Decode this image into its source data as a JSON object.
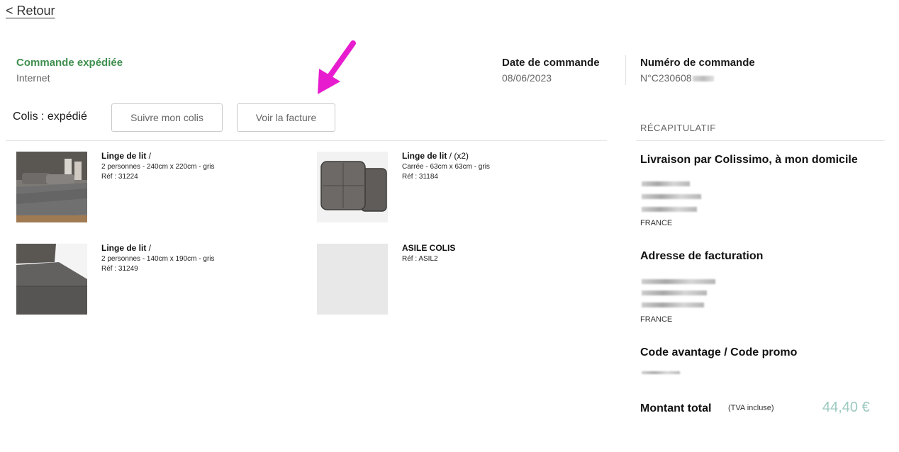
{
  "nav": {
    "back_label": "< Retour"
  },
  "order": {
    "status": "Commande expédiée",
    "channel": "Internet",
    "date_label": "Date de commande",
    "date_value": "08/06/2023",
    "number_label": "Numéro de commande",
    "number_value": "N°C230608"
  },
  "parcel": {
    "label": "Colis : expédié",
    "track_button": "Suivre mon colis",
    "invoice_button": "Voir la facture"
  },
  "products": [
    {
      "name": "Linge de lit",
      "sep": " /",
      "qty": "",
      "desc": "2 personnes - 240cm x 220cm - gris",
      "ref": "Réf : 31224"
    },
    {
      "name": "Linge de lit",
      "sep": " /",
      "qty": " (x2)",
      "desc": "Carrée - 63cm x 63cm - gris",
      "ref": "Réf : 31184"
    },
    {
      "name": "Linge de lit",
      "sep": " /",
      "qty": "",
      "desc": "2 personnes - 140cm x 190cm - gris",
      "ref": "Réf : 31249"
    },
    {
      "name": "ASILE COLIS",
      "sep": "",
      "qty": "",
      "desc": "",
      "ref": "Réf : ASIL2"
    }
  ],
  "summary": {
    "heading": "RÉCAPITULATIF",
    "delivery_title": "Livraison par Colissimo, à mon domicile",
    "delivery_country": "FRANCE",
    "billing_title": "Adresse de facturation",
    "billing_country": "FRANCE",
    "promo_title": "Code avantage / Code promo",
    "total_label": "Montant total",
    "total_note": "(TVA incluse)",
    "total_value": "44,40 €"
  },
  "colors": {
    "status_green": "#3f8f4f",
    "total_teal": "#9cc9c0",
    "arrow_magenta": "#e81ccf"
  }
}
